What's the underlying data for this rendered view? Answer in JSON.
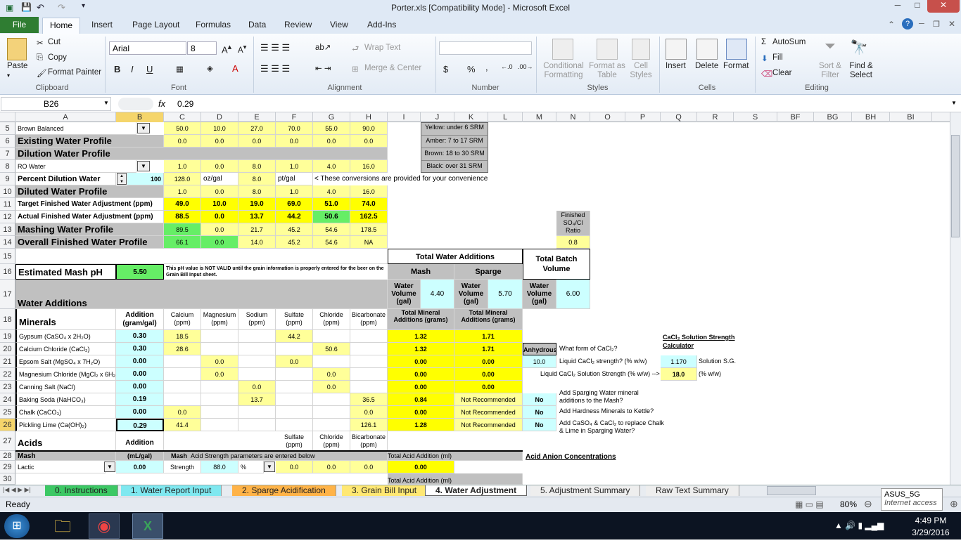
{
  "window": {
    "title": "Porter.xls  [Compatibility Mode]  -  Microsoft Excel",
    "minimize": "─",
    "maximize": "□",
    "close": "✕"
  },
  "ribbon_tabs": [
    "File",
    "Home",
    "Insert",
    "Page Layout",
    "Formulas",
    "Data",
    "Review",
    "View",
    "Add-Ins"
  ],
  "ribbon": {
    "paste": "Paste",
    "cut": "Cut",
    "copy": "Copy",
    "format_painter": "Format Painter",
    "clipboard": "Clipboard",
    "font_name": "Arial",
    "font_size": "8",
    "bold": "B",
    "italic": "I",
    "underline": "U",
    "font": "Font",
    "wrap_text": "Wrap Text",
    "merge_center": "Merge & Center",
    "alignment": "Alignment",
    "number": "Number",
    "currency": "$",
    "percent": "%",
    "comma": ",",
    "conditional": "Conditional Formatting",
    "format_table": "Format as Table",
    "cell_styles": "Cell Styles",
    "styles": "Styles",
    "insert": "Insert",
    "delete": "Delete",
    "format": "Format",
    "cells": "Cells",
    "autosum": "AutoSum",
    "fill": "Fill",
    "clear": "Clear",
    "sort_filter": "Sort & Filter",
    "find_select": "Find & Select",
    "editing": "Editing"
  },
  "formula_bar": {
    "name_box": "B26",
    "fx": "fx",
    "value": "0.29"
  },
  "columns": [
    "A",
    "B",
    "C",
    "D",
    "E",
    "F",
    "G",
    "H",
    "I",
    "J",
    "K",
    "L",
    "M",
    "N",
    "O",
    "P",
    "Q",
    "R",
    "S",
    "BF",
    "BG",
    "BH",
    "BI"
  ],
  "rows": [
    "5",
    "6",
    "7",
    "8",
    "9",
    "10",
    "11",
    "12",
    "13",
    "14",
    "15",
    "16",
    "17",
    "18",
    "19",
    "20",
    "21",
    "22",
    "23",
    "24",
    "25",
    "26",
    "27",
    "28",
    "29",
    "30"
  ],
  "cells": {
    "r5a": "Brown Balanced",
    "r5": [
      "50.0",
      "10.0",
      "27.0",
      "70.0",
      "55.0",
      "90.0"
    ],
    "r6a": "Existing Water Profile",
    "r6": [
      "0.0",
      "0.0",
      "0.0",
      "0.0",
      "0.0",
      "0.0"
    ],
    "r7a": "Dilution Water Profile",
    "r8a": "RO Water",
    "r8": [
      "1.0",
      "0.0",
      "8.0",
      "1.0",
      "4.0",
      "16.0"
    ],
    "r9a": "Percent Dilution Water",
    "r9b": "100",
    "r9c": "128.0",
    "r9d": "oz/gal",
    "r9e": "8.0",
    "r9f": "pt/gal",
    "r9note": "< These conversions are provided for your convenience",
    "r10a": "Diluted Water Profile",
    "r10": [
      "1.0",
      "0.0",
      "8.0",
      "1.0",
      "4.0",
      "16.0"
    ],
    "r11a": "Target Finished Water Adjustment (ppm)",
    "r11": [
      "49.0",
      "10.0",
      "19.0",
      "69.0",
      "51.0",
      "74.0"
    ],
    "r12a": "Actual Finished Water Adjustment (ppm)",
    "r12": [
      "88.5",
      "0.0",
      "13.7",
      "44.2",
      "50.6",
      "162.5"
    ],
    "r13a": "Mashing Water Profile",
    "r13": [
      "89.5",
      "0.0",
      "21.7",
      "45.2",
      "54.6",
      "178.5"
    ],
    "r14a": "Overall Finished Water Profile",
    "r14": [
      "66.1",
      "0.0",
      "14.0",
      "45.2",
      "54.6",
      "NA"
    ],
    "srm": [
      "Yellow: under 6 SRM",
      "Amber: 7 to 17 SRM",
      "Brown: 18 to 30 SRM",
      "Black: over 31 SRM"
    ],
    "so4cl_label": "Finished SO₄/Cl Ratio",
    "so4cl": "0.8",
    "total_water": "Total Water Additions",
    "mash": "Mash",
    "sparge": "Sparge",
    "total_batch": "Total Batch Volume",
    "water_volume": "Water Volume (gal)",
    "mash_vol": "4.40",
    "sparge_vol": "5.70",
    "batch_vol": "6.00",
    "est_ph_label": "Estimated Mash pH",
    "est_ph": "5.50",
    "ph_note": "This pH value is NOT VALID until the grain information is properly entered for the beer on the Grain Bill Input sheet.",
    "water_additions": "Water Additions",
    "minerals": "Minerals",
    "addition_hdr": "Addition (gram/gal)",
    "ion_hdrs": [
      "Calcium (ppm)",
      "Magnesium (ppm)",
      "Sodium (ppm)",
      "Sulfate (ppm)",
      "Chloride (ppm)",
      "Bicarbonate (ppm)"
    ],
    "total_mineral": "Total Mineral Additions (grams)",
    "minerals_list": [
      {
        "name": "Gypsum (CaSO₄ x 2H₂O)",
        "add": "0.30",
        "ca": "18.5",
        "mg": "",
        "na": "",
        "so4": "44.2",
        "cl": "",
        "hco3": "",
        "mash": "1.32",
        "sparge": "1.71"
      },
      {
        "name": "Calcium Chloride (CaCl₂)",
        "add": "0.30",
        "ca": "28.6",
        "mg": "",
        "na": "",
        "so4": "",
        "cl": "50.6",
        "hco3": "",
        "mash": "1.32",
        "sparge": "1.71"
      },
      {
        "name": "Epsom Salt (MgSO₄ x 7H₂O)",
        "add": "0.00",
        "ca": "",
        "mg": "0.0",
        "na": "",
        "so4": "0.0",
        "cl": "",
        "hco3": "",
        "mash": "0.00",
        "sparge": "0.00"
      },
      {
        "name": "Magnesium Chloride (MgCl₂ x 6H₂O)",
        "add": "0.00",
        "ca": "",
        "mg": "0.0",
        "na": "",
        "so4": "",
        "cl": "0.0",
        "hco3": "",
        "mash": "0.00",
        "sparge": "0.00"
      },
      {
        "name": "Canning Salt (NaCl)",
        "add": "0.00",
        "ca": "",
        "mg": "",
        "na": "0.0",
        "so4": "",
        "cl": "0.0",
        "hco3": "",
        "mash": "0.00",
        "sparge": "0.00"
      },
      {
        "name": "Baking Soda (NaHCO₃)",
        "add": "0.19",
        "ca": "",
        "mg": "",
        "na": "13.7",
        "so4": "",
        "cl": "",
        "hco3": "36.5",
        "mash": "0.84",
        "sparge": "Not Recommended"
      },
      {
        "name": "Chalk (CaCO₃)",
        "add": "0.00",
        "ca": "0.0",
        "mg": "",
        "na": "",
        "so4": "",
        "cl": "",
        "hco3": "0.0",
        "mash": "0.00",
        "sparge": "Not Recommended"
      },
      {
        "name": "Pickling Lime (Ca(OH)₂)",
        "add": "0.29",
        "ca": "41.4",
        "mg": "",
        "na": "",
        "so4": "",
        "cl": "",
        "hco3": "126.1",
        "mash": "1.28",
        "sparge": "Not Recommended"
      }
    ],
    "anhydrous": "Anhydrous",
    "cacl_form": "What form of CaCl₂?",
    "liquid_strength": "Liquid CaCl₂ strength? (% w/w)",
    "liquid_val": "10.0",
    "liquid_sol": "Liquid CaCl₂ Solution Strength (% w/w) -->",
    "liquid_sol_val": "18.0",
    "pct_ww": "(% w/w)",
    "calc_title": "CaCl₂ Solution Strength Calculator",
    "sg_val": "1.170",
    "sg_label": "Solution S.G.",
    "q24": "Add Sparging Water mineral additions to the Mash?",
    "q24v": "No",
    "q25": "Add Hardness Minerals to Kettle?",
    "q25v": "No",
    "q26": "Add CaSO₄ & CaCl₂ to replace Chalk & Lime in Sparging Water?",
    "q26v": "No",
    "acids": "Acids",
    "acid_add": "Addition",
    "acid_hdrs": [
      "Sulfate (ppm)",
      "Chloride (ppm)",
      "Bicarbonate (ppm)"
    ],
    "r28a": "Mash",
    "r28b": "(mL/gal)",
    "r28c": "Mash",
    "r28d": "Acid Strength parameters are entered below",
    "r28i": "Total Acid Addition (ml)",
    "acid_anion": "Acid Anion Concentrations",
    "r29a": "Lactic",
    "r29b": "0.00",
    "r29c": "Strength",
    "r29d": "88.0",
    "r29e": "%",
    "r29f": "0.0",
    "r29g": "0.0",
    "r29h": "0.0",
    "r29i": "0.00",
    "r30i": "Total Acid Addition (ml)"
  },
  "sheet_tabs": [
    {
      "label": "0. Instructions",
      "color": "#3cc864"
    },
    {
      "label": "1. Water Report Input",
      "color": "#7fe8f0"
    },
    {
      "label": "2. Sparge Acidification",
      "color": "#ffb347"
    },
    {
      "label": "3. Grain Bill Input",
      "color": "#ffe873"
    },
    {
      "label": "4. Water Adjustment",
      "color": "#ffffff"
    },
    {
      "label": "5. Adjustment Summary",
      "color": "#eeeeee"
    },
    {
      "label": "Raw Text Summary",
      "color": "#eeeeee"
    }
  ],
  "status": {
    "ready": "Ready",
    "zoom": "80%",
    "wifi": "ASUS_5G",
    "wifi_sub": "Internet access"
  },
  "taskbar": {
    "time": "4:49 PM",
    "date": "3/29/2016"
  }
}
